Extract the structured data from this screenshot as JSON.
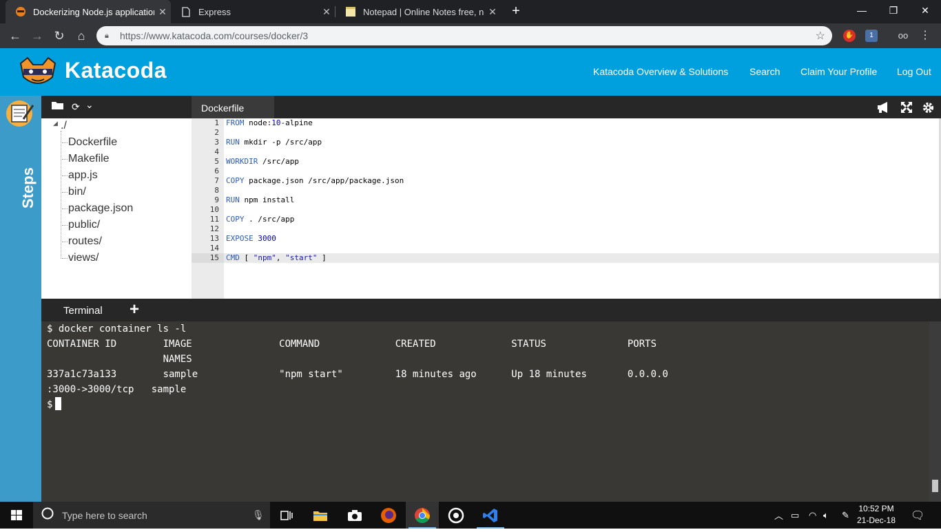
{
  "browser": {
    "tabs": [
      {
        "title": "Dockerizing Node.js applications",
        "active": true,
        "icon": "tiger-favicon-icon"
      },
      {
        "title": "Express",
        "active": false,
        "icon": "page-icon"
      },
      {
        "title": "Notepad | Online Notes free, no",
        "active": false,
        "icon": "notepad-favicon-icon"
      }
    ],
    "url": "https://www.katacoda.com/courses/docker/3",
    "extension_badge": "1"
  },
  "header": {
    "brand": "Katacoda",
    "nav": [
      "Katacoda Overview & Solutions",
      "Search",
      "Claim Your Profile",
      "Log Out"
    ]
  },
  "sidebar": {
    "steps_label": "Steps"
  },
  "filetree": {
    "root": "./",
    "items": [
      "Dockerfile",
      "Makefile",
      "app.js",
      "bin/",
      "package.json",
      "public/",
      "routes/",
      "views/"
    ]
  },
  "editor": {
    "tab": "Dockerfile",
    "current_line": 15,
    "lines": [
      {
        "n": "1",
        "kw": "FROM",
        "rest": " node:",
        "num": "10",
        "tail": "-alpine"
      },
      {
        "n": "2"
      },
      {
        "n": "3",
        "kw": "RUN",
        "rest": " mkdir -p /src/app"
      },
      {
        "n": "4"
      },
      {
        "n": "5",
        "kw": "WORKDIR",
        "rest": " /src/app"
      },
      {
        "n": "6"
      },
      {
        "n": "7",
        "kw": "COPY",
        "rest": " package.json /src/app/package.json"
      },
      {
        "n": "8"
      },
      {
        "n": "9",
        "kw": "RUN",
        "rest": " npm install"
      },
      {
        "n": "10"
      },
      {
        "n": "11",
        "kw": "COPY",
        "rest": " . /src/app"
      },
      {
        "n": "12"
      },
      {
        "n": "13",
        "kw": "EXPOSE",
        "rest": " ",
        "num": "3000"
      },
      {
        "n": "14"
      },
      {
        "n": "15",
        "kw": "CMD",
        "rest": " [ ",
        "str1": "\"npm\"",
        "mid": ", ",
        "str2": "\"start\"",
        "tail": " ]"
      }
    ]
  },
  "terminal": {
    "tab": "Terminal",
    "lines": [
      "$ docker container ls -l",
      "CONTAINER ID        IMAGE               COMMAND             CREATED             STATUS              PORTS",
      "                    NAMES",
      "337a1c73a133        sample              \"npm start\"         18 minutes ago      Up 18 minutes       0.0.0.0",
      ":3000->3000/tcp   sample"
    ],
    "prompt": "$"
  },
  "taskbar": {
    "search_placeholder": "Type here to search",
    "time": "10:52 PM",
    "date": "21-Dec-18"
  }
}
